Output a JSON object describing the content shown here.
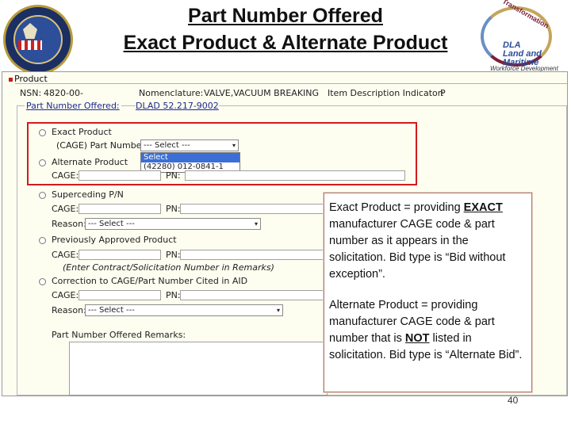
{
  "slide": {
    "title_line1": "Part Number Offered",
    "title_line2": "Exact Product & Alternate Product",
    "page_number": "40",
    "logo": {
      "ring_text": "Transformation",
      "center_text": [
        "DLA",
        "Land and",
        "Maritime"
      ],
      "caption": "Workforce Development"
    }
  },
  "app": {
    "product_legend": "Product",
    "nsn_label": "NSN:",
    "nsn_value": "4820-00-",
    "nomenclature_label": "Nomenclature:",
    "nomenclature_value": "VALVE,VACUUM BREAKING",
    "idi_label": "Item Description Indicator:",
    "idi_value": "P",
    "part_number_offered_legend": "Part Number Offered:",
    "dlad_link": "DLAD 52.217-9002",
    "exact_product": {
      "radio_label": "Exact Product",
      "cage_pn_label": "(CAGE) Part Number:",
      "select_value": "--- Select ---",
      "dropdown_options": [
        "Select",
        "(42280) 012-0841-1"
      ],
      "selected_option_index": 0
    },
    "alternate_product": {
      "radio_label": "Alternate Product",
      "cage_label": "CAGE:",
      "pn_label": "PN:"
    },
    "superseding": {
      "radio_label": "Superceding P/N",
      "cage_label": "CAGE:",
      "pn_label": "PN:",
      "reason_label": "Reason:",
      "reason_value": "--- Select ---"
    },
    "previously_approved": {
      "radio_label": "Previously Approved Product",
      "cage_label": "CAGE:",
      "pn_label": "PN:",
      "note": "(Enter Contract/Solicitation Number in Remarks)"
    },
    "correction": {
      "radio_label": "Correction to CAGE/Part Number Cited in AID",
      "cage_label": "CAGE:",
      "pn_label": "PN:",
      "reason_label": "Reason:",
      "reason_value": "--- Select ---"
    },
    "remarks_label": "Part Number Offered Remarks:"
  },
  "callout": {
    "exact": {
      "prefix": "Exact Product = providing ",
      "emphasis": "EXACT",
      "suffix": " manufacturer CAGE code & part number as it appears in the solicitation.  Bid type is “Bid without exception”."
    },
    "alternate": {
      "prefix": "Alternate Product =  providing manufacturer CAGE code & part number that is ",
      "emphasis": "NOT",
      "suffix": " listed in solicitation.  Bid type is “Alternate Bid”."
    }
  },
  "colors": {
    "highlight_box": "#d11c1c",
    "link": "#1c2a8c",
    "form_background": "#fdfdf0",
    "selected_option": "#3b6fd6"
  }
}
